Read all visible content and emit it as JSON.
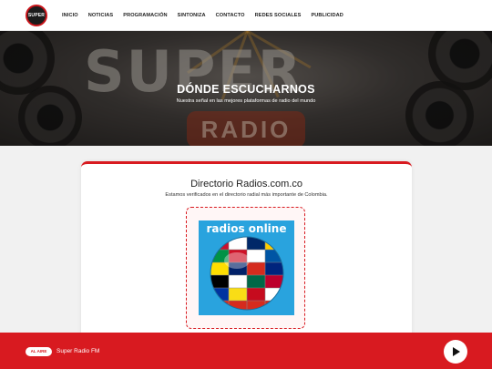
{
  "logo": {
    "text": "SUPER"
  },
  "nav": {
    "items": [
      {
        "label": "INICIO"
      },
      {
        "label": "NOTICIAS"
      },
      {
        "label": "PROGRAMACIÓN"
      },
      {
        "label": "SINTONIZA"
      },
      {
        "label": "CONTACTO"
      },
      {
        "label": "REDES SOCIALES"
      },
      {
        "label": "PUBLICIDAD"
      }
    ]
  },
  "hero": {
    "title": "DÓNDE ESCUCHARNOS",
    "subtitle": "Nuestra señal en las mejores plataformas de radio del mundo",
    "image_text_big": "SUPER",
    "image_text_small": "RADIO"
  },
  "directory": {
    "title": "Directorio Radios.com.co",
    "subtitle": "Estamos verificados en el directorio radial más importante de Colombia.",
    "badge_text": "radios online"
  },
  "player": {
    "on_air_label": "AL AIRE",
    "station_name": "Super Radio FM"
  },
  "colors": {
    "accent": "#d81a20",
    "badge_bg": "#29a3de"
  },
  "icons": {
    "play": "play-icon"
  }
}
